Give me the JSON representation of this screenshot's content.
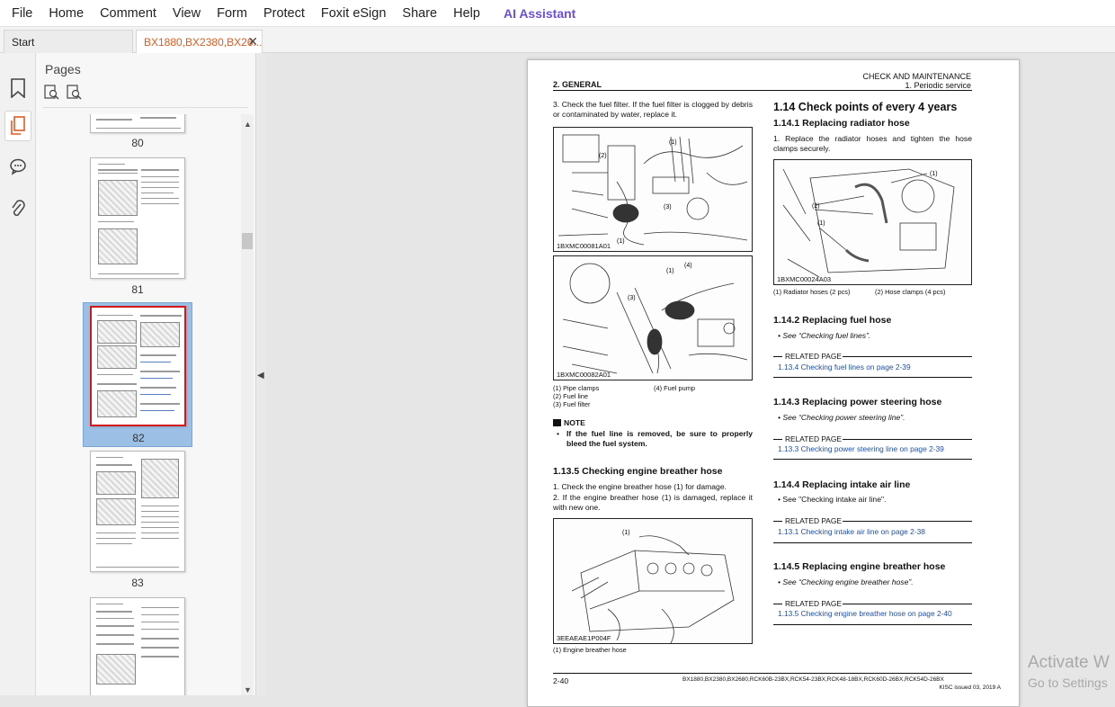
{
  "menubar": {
    "items": [
      "File",
      "Home",
      "Comment",
      "View",
      "Form",
      "Protect",
      "Foxit eSign",
      "Share",
      "Help"
    ],
    "ai_assistant": "AI Assistant"
  },
  "tabs": {
    "start": "Start",
    "document": "BX1880,BX2380,BX26..."
  },
  "pages_panel": {
    "title": "Pages",
    "thumbnails": [
      {
        "page": "80"
      },
      {
        "page": "81"
      },
      {
        "page": "82",
        "selected": true
      },
      {
        "page": "83"
      }
    ]
  },
  "document": {
    "header_right_1": "CHECK AND MAINTENANCE",
    "header_right_2": "1. Periodic service",
    "header_left": "2. GENERAL",
    "step3": "3.   Check the fuel filter. If the fuel filter is clogged by debris or contaminated by water, replace it.",
    "fig1_id": "1BXMC00081A01",
    "fig2_id": "1BXMC00082A01",
    "cap_1": "(1)   Pipe clamps",
    "cap_2": "(2)   Fuel line",
    "cap_3": "(3)   Fuel filter",
    "cap_4": "(4)   Fuel pump",
    "note_title": "NOTE",
    "note_text": "If the fuel line is removed, be sure to properly bleed the fuel system.",
    "s1135_title": "1.13.5 Checking engine breather hose",
    "s1135_step1": "1.   Check the engine breather hose (1) for damage.",
    "s1135_step2": "2.   If the engine breather hose (1) is damaged, replace it with new one.",
    "fig3_id": "3EEAEAE1P004F",
    "fig3_cap": "(1)   Engine breather hose",
    "s114_title": "1.14 Check points of every 4 years",
    "s1141_title": "1.14.1 Replacing radiator hose",
    "s1141_step1": "1.   Replace the radiator hoses and tighten the hose clamps securely.",
    "fig4_id": "1BXMC00024A03",
    "fig4_cap1": "(1)   Radiator hoses (2 pcs)",
    "fig4_cap2": "(2)   Hose clamps (4 pcs)",
    "s1142_title": "1.14.2 Replacing fuel hose",
    "s1142_text": "•   See “Checking fuel lines”.",
    "related_label": "RELATED PAGE",
    "s1142_link": "1.13.4  Checking fuel lines on page 2-39",
    "s1143_title": "1.14.3 Replacing power steering hose",
    "s1143_text": "•   See “Checking power steering line”.",
    "s1143_link": "1.13.3  Checking power steering line on page 2-39",
    "s1144_title": "1.14.4 Replacing intake air line",
    "s1144_text": "•   See \"Checking intake air line\".",
    "s1144_link": "1.13.1  Checking intake air line on page 2-38",
    "s1145_title": "1.14.5 Replacing engine breather hose",
    "s1145_text": "•   See “Checking engine breather hose”.",
    "s1145_link": "1.13.5  Checking engine breather hose on page 2-40",
    "footer_page": "2-40",
    "footer_models": "BX1880,BX2380,BX2680,RCK60B-23BX,RCK54-23BX,RCK48-18BX,RCK60D-26BX,RCK54D-26BX",
    "footer_issue": "KISC issued 03, 2019 A"
  },
  "watermark": {
    "line1": "Activate W",
    "line2": "Go to Settings"
  }
}
